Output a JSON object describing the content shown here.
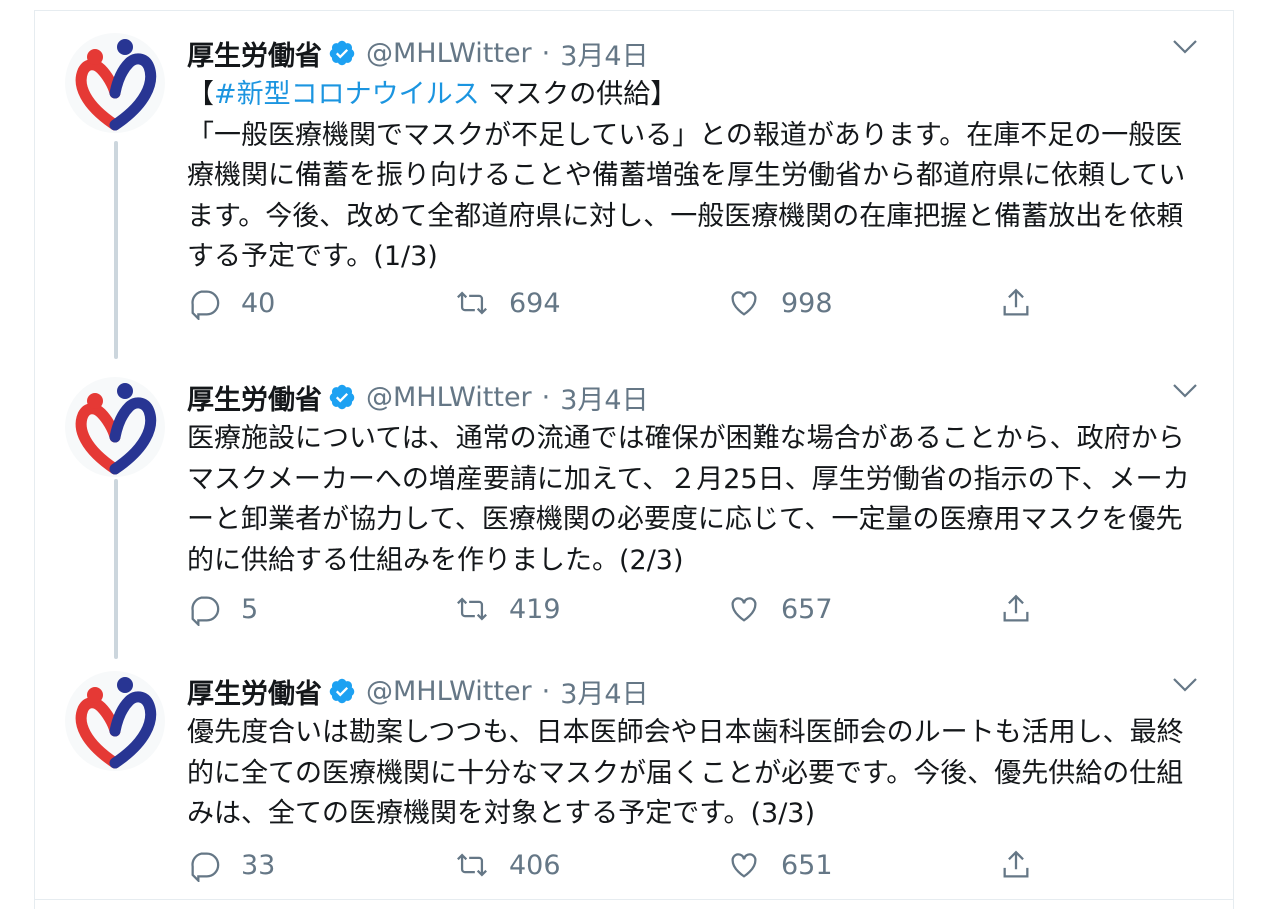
{
  "account": {
    "name": "厚生労働省",
    "handle": "@MHLWitter",
    "separator": "·",
    "avatar_icon": "mhlw-logo-icon",
    "verified_icon": "verified-badge-icon"
  },
  "colors": {
    "link": "#1b95e0",
    "muted": "#657786",
    "verified": "#1da1f2",
    "logo_red": "#e53935",
    "logo_blue": "#283593"
  },
  "tweets": [
    {
      "date": "3月4日",
      "hashtag_prefix": "【",
      "hashtag": "#新型コロナウイルス",
      "title_rest": " マスクの供給】",
      "text": "「一般医療機関でマスクが不足している」との報道があります。在庫不足の一般医療機関に備蓄を振り向けることや備蓄増強を厚生労働省から都道府県に依頼しています。今後、改めて全都道府県に対し、一般医療機関の在庫把握と備蓄放出を依頼する予定です。(1/3)",
      "replies": "40",
      "retweets": "694",
      "likes": "998"
    },
    {
      "date": "3月4日",
      "text": "医療施設については、通常の流通では確保が困難な場合があることから、政府からマスクメーカーへの増産要請に加えて、２月25日、厚生労働省の指示の下、メーカーと卸業者が協力して、医療機関の必要度に応じて、一定量の医療用マスクを優先的に供給する仕組みを作りました。(2/3)",
      "replies": "5",
      "retweets": "419",
      "likes": "657"
    },
    {
      "date": "3月4日",
      "text": "優先度合いは勘案しつつも、日本医師会や日本歯科医師会のルートも活用し、最終的に全ての医療機関に十分なマスクが届くことが必要です。今後、優先供給の仕組みは、全ての医療機関を対象とする予定です。(3/3)",
      "replies": "33",
      "retweets": "406",
      "likes": "651"
    }
  ]
}
